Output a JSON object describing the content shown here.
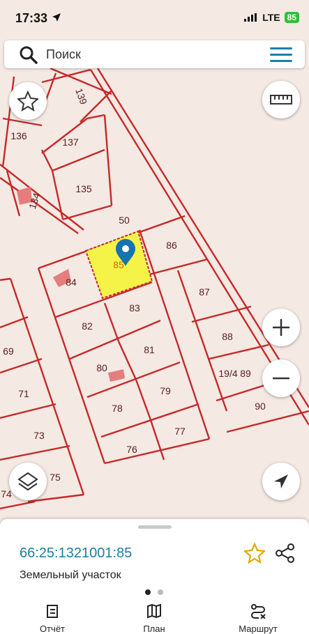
{
  "status_bar": {
    "time": "17:33",
    "network": "LTE",
    "battery": "85"
  },
  "search": {
    "placeholder": "Поиск"
  },
  "map": {
    "parcel_labels": [
      "139",
      "136",
      "137",
      "134",
      "135",
      "50",
      "86",
      "85",
      "84",
      "83",
      "87",
      "82",
      "69",
      "81",
      "88",
      "80",
      "19/4",
      "89",
      "71",
      "78",
      "79",
      "90",
      "73",
      "76",
      "77",
      "75",
      "74"
    ],
    "highlighted_parcel": "85",
    "colors": {
      "parcel_line": "#c62828",
      "background": "#f4e9e3",
      "highlight": "#f6f348",
      "label": "#5a2020",
      "building": "#e57d7d"
    }
  },
  "sheet": {
    "cadastral_number": "66:25:1321001:85",
    "type": "Земельный участок"
  },
  "tabs": [
    {
      "label": "Отчёт",
      "icon": "report-icon"
    },
    {
      "label": "План",
      "icon": "map-icon"
    },
    {
      "label": "Маршрут",
      "icon": "route-icon"
    }
  ]
}
